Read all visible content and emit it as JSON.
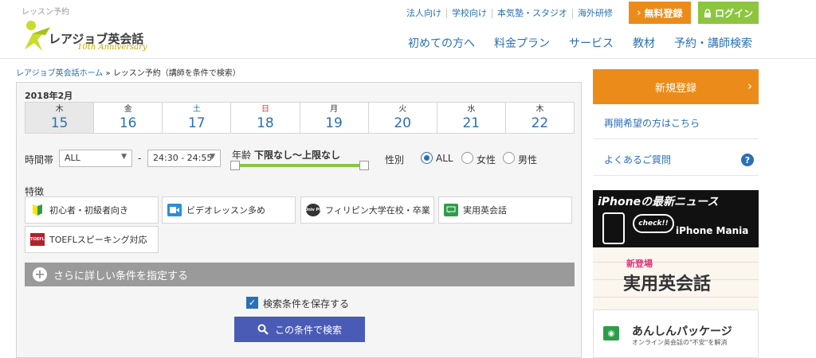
{
  "header": {
    "tagline": "レッスン予約",
    "logo_text": "レアジョブ英会話",
    "logo_sub": "10th Anniversary",
    "top_links": [
      "法人向け",
      "学校向け",
      "本気塾・スタジオ",
      "海外研修"
    ],
    "register_label": "無料登録",
    "login_label": "ログイン",
    "nav": [
      "初めての方へ",
      "料金プラン",
      "サービス",
      "教材",
      "予約・講師検索"
    ]
  },
  "breadcrumb": {
    "home": "レアジョブ英会話ホーム",
    "separator": "»",
    "current": "レッスン予約（講師を条件で検索）"
  },
  "calendar": {
    "month": "2018年2月",
    "days": [
      {
        "dow": "木",
        "day": "15"
      },
      {
        "dow": "金",
        "day": "16"
      },
      {
        "dow": "土",
        "day": "17"
      },
      {
        "dow": "日",
        "day": "18"
      },
      {
        "dow": "月",
        "day": "19"
      },
      {
        "dow": "火",
        "day": "20"
      },
      {
        "dow": "水",
        "day": "21"
      },
      {
        "dow": "木",
        "day": "22"
      }
    ]
  },
  "filters": {
    "time_label": "時間帯",
    "time_from": "ALL",
    "time_dash": "-",
    "time_to": "24:30 - 24:55",
    "age_label": "年齢",
    "age_value": "下限なし〜上限なし",
    "gender_label": "性別",
    "gender_options": [
      "ALL",
      "女性",
      "男性"
    ],
    "gender_selected": "ALL"
  },
  "features": {
    "label": "特徴",
    "items": [
      {
        "label": "初心者・初級者向き",
        "icon": "beginner-icon"
      },
      {
        "label": "ビデオレッスン多め",
        "icon": "video-icon"
      },
      {
        "label": "フィリピン大学在校・卒業",
        "icon": "university-icon",
        "icon_text": "Univ Ph"
      },
      {
        "label": "実用英会話",
        "icon": "conversation-icon"
      },
      {
        "label": "TOEFLスピーキング対応",
        "icon": "toefl-icon",
        "icon_text": "TOEFL"
      }
    ]
  },
  "more_label": "さらに詳しい条件を指定する",
  "save_label": "検索条件を保存する",
  "save_checked": true,
  "search_button": "この条件で検索",
  "sidebar": {
    "register": "新規登録",
    "links": [
      "再開希望の方はこちら",
      "よくあるご質問"
    ],
    "banner_iphone_title": "iPhoneの最新ニュース",
    "banner_iphone_check": "check!!",
    "banner_iphone_sub": "iPhone Mania",
    "banner_jitsuyo_badge": "新登場",
    "banner_jitsuyo_title": "実用英会話",
    "banner_anshin_title": "あんしんパッケージ",
    "banner_anshin_sub": "オンライン英会話の\"不安\"を解消"
  },
  "colors": {
    "link_blue": "#2a6fb6",
    "orange": "#eb8c1a",
    "green": "#8cc63f",
    "search_button": "#4a5bb5",
    "sunday_red": "#e0392c"
  }
}
